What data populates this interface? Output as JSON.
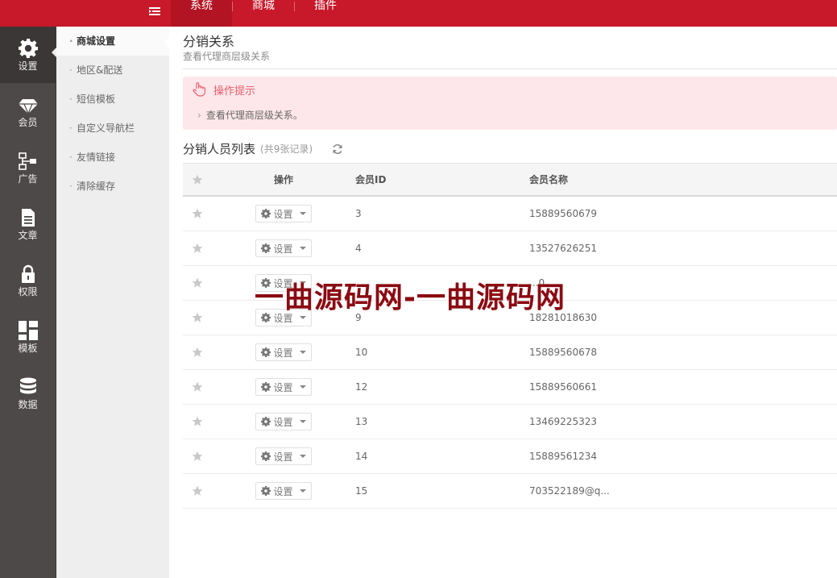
{
  "topbar": {
    "tabs": [
      {
        "label": "系统",
        "active": true
      },
      {
        "label": "商城",
        "active": false
      },
      {
        "label": "插件",
        "active": false
      }
    ]
  },
  "iconbar": {
    "items": [
      {
        "label": "设置",
        "icon": "gear-icon",
        "active": true
      },
      {
        "label": "会员",
        "icon": "diamond-icon",
        "active": false
      },
      {
        "label": "广告",
        "icon": "sitemap-icon",
        "active": false
      },
      {
        "label": "文章",
        "icon": "document-icon",
        "active": false
      },
      {
        "label": "权限",
        "icon": "lock-icon",
        "active": false
      },
      {
        "label": "模板",
        "icon": "dashboard-icon",
        "active": false
      },
      {
        "label": "数据",
        "icon": "database-icon",
        "active": false
      }
    ]
  },
  "submenu": {
    "items": [
      {
        "label": "商城设置",
        "active": true
      },
      {
        "label": "地区&配送",
        "active": false
      },
      {
        "label": "短信模板",
        "active": false
      },
      {
        "label": "自定义导航栏",
        "active": false
      },
      {
        "label": "友情链接",
        "active": false
      },
      {
        "label": "清除缓存",
        "active": false
      }
    ]
  },
  "page": {
    "title": "分销关系",
    "subtitle": "查看代理商层级关系"
  },
  "tip": {
    "title": "操作提示",
    "line": "查看代理商层级关系。"
  },
  "list": {
    "title": "分销人员列表",
    "count": "(共9张记录)"
  },
  "table": {
    "headers": {
      "op": "操作",
      "id": "会员ID",
      "name": "会员名称"
    },
    "op_label": "设置",
    "rows": [
      {
        "id": "3",
        "name": "15889560679"
      },
      {
        "id": "4",
        "name": "13527626251"
      },
      {
        "id": "",
        "name": "...0"
      },
      {
        "id": "9",
        "name": "18281018630"
      },
      {
        "id": "10",
        "name": "15889560678"
      },
      {
        "id": "12",
        "name": "15889560661"
      },
      {
        "id": "13",
        "name": "13469225323"
      },
      {
        "id": "14",
        "name": "15889561234"
      },
      {
        "id": "15",
        "name": "703522189@q..."
      }
    ]
  },
  "watermark": "一曲源码网-一曲源码网",
  "colors": {
    "brand": "#c8192a",
    "sidebar": "#4d4948",
    "tip_bg": "#fde7ea",
    "tip_text": "#e8606d"
  }
}
